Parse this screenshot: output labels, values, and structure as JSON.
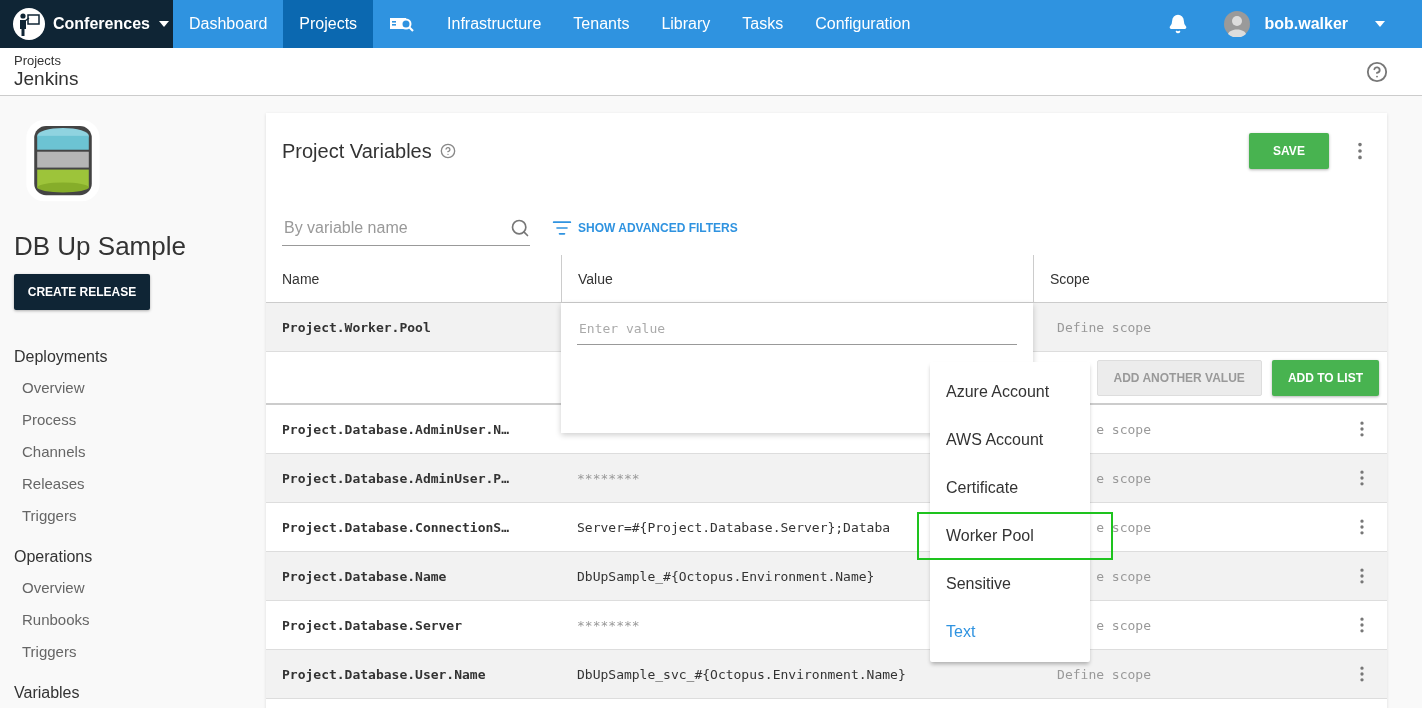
{
  "nav": {
    "brand": "Conferences",
    "items": [
      {
        "kind": "text",
        "label": "Dashboard",
        "selected": false
      },
      {
        "kind": "text",
        "label": "Projects",
        "selected": true
      },
      {
        "kind": "icon",
        "selected": false
      },
      {
        "kind": "text",
        "label": "Infrastructure",
        "selected": false
      },
      {
        "kind": "text",
        "label": "Tenants",
        "selected": false
      },
      {
        "kind": "text",
        "label": "Library",
        "selected": false
      },
      {
        "kind": "text",
        "label": "Tasks",
        "selected": false
      },
      {
        "kind": "text",
        "label": "Configuration",
        "selected": false
      }
    ],
    "user": "bob.walker"
  },
  "header": {
    "breadcrumb": "Projects",
    "title": "Jenkins"
  },
  "sidebar": {
    "project": "DB Up Sample",
    "create_button": "CREATE RELEASE",
    "sections": [
      {
        "title": "Deployments",
        "items": [
          "Overview",
          "Process",
          "Channels",
          "Releases",
          "Triggers"
        ]
      },
      {
        "title": "Operations",
        "items": [
          "Overview",
          "Runbooks",
          "Triggers"
        ]
      },
      {
        "title": "Variables"
      }
    ]
  },
  "variables": {
    "title": "Project Variables",
    "save": "SAVE",
    "search": {
      "placeholder": "By variable name"
    },
    "filters_link": "SHOW ADVANCED FILTERS",
    "columns": [
      "Name",
      "Value",
      "Scope"
    ],
    "editing": {
      "name": "Project.Worker.Pool",
      "placeholder": "Enter value",
      "scope": "Define scope",
      "buttons": [
        {
          "label": "ADD ANOTHER VALUE",
          "disabled": true
        },
        {
          "label": "ADD TO LIST",
          "disabled": false
        }
      ]
    },
    "rows": [
      {
        "name": "Project.Database.AdminUser.N…",
        "scope": "e scope"
      },
      {
        "name": "Project.Database.AdminUser.P…",
        "kind": "sensitive",
        "value": "********",
        "scope": "e scope"
      },
      {
        "name": "Project.Database.ConnectionS…",
        "kind": "text",
        "value": "Server=#{Project.Database.Server};Databa",
        "scope": "e scope"
      },
      {
        "name": "Project.Database.Name",
        "kind": "text",
        "value": "DbUpSample_#{Octopus.Environment.Name}",
        "scope": "e scope"
      },
      {
        "name": "Project.Database.Server",
        "kind": "sensitive",
        "value": "********",
        "scope": "e scope"
      },
      {
        "name": "Project.Database.User.Name",
        "kind": "text",
        "value": "DbUpSample_svc_#{Octopus.Environment.Name}",
        "scope": "Define scope"
      }
    ],
    "type_menu": [
      {
        "label": "Azure Account",
        "selected": false,
        "outlined": false
      },
      {
        "label": "AWS Account",
        "selected": false,
        "outlined": false
      },
      {
        "label": "Certificate",
        "selected": false,
        "outlined": false
      },
      {
        "label": "Worker Pool",
        "selected": false,
        "outlined": true
      },
      {
        "label": "Sensitive",
        "selected": false,
        "outlined": false
      },
      {
        "label": "Text",
        "selected": true,
        "outlined": false
      }
    ]
  }
}
